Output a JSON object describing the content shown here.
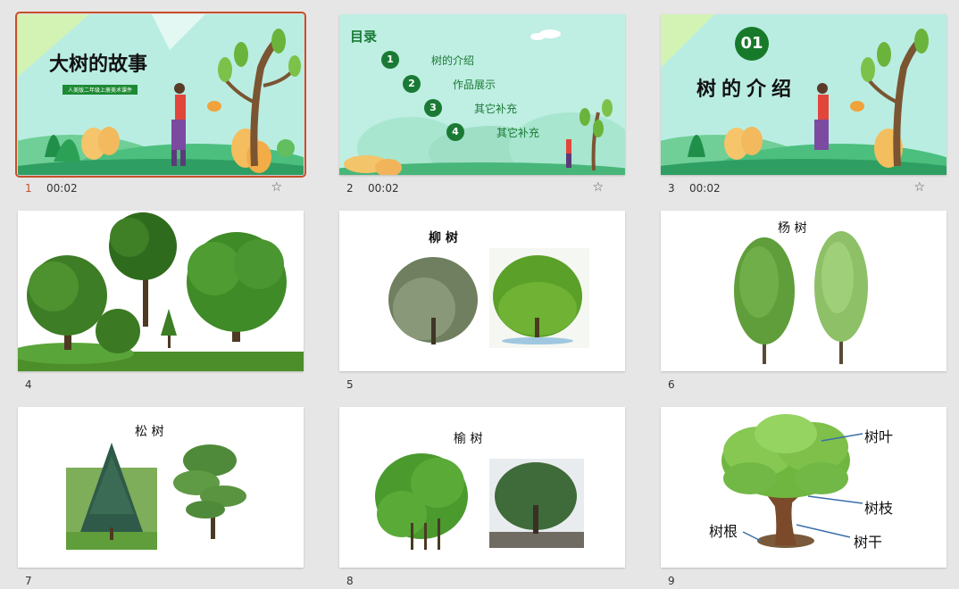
{
  "slides": [
    {
      "number": "1",
      "time": "00:02",
      "title": "大树的故事",
      "subtitle": "人美版二年级上册美术课件",
      "star": "☆"
    },
    {
      "number": "2",
      "time": "00:02",
      "heading": "目录",
      "items": [
        {
          "num": "1",
          "label": "树的介绍"
        },
        {
          "num": "2",
          "label": "作品展示"
        },
        {
          "num": "3",
          "label": "其它补充"
        },
        {
          "num": "4",
          "label": "其它补充"
        }
      ],
      "star": "☆"
    },
    {
      "number": "3",
      "time": "00:02",
      "badge": "01",
      "title": "树的介绍",
      "star": "☆"
    },
    {
      "number": "4"
    },
    {
      "number": "5",
      "title": "柳 树"
    },
    {
      "number": "6",
      "title": "杨 树"
    },
    {
      "number": "7",
      "title": "松 树"
    },
    {
      "number": "8",
      "title": "榆 树"
    },
    {
      "number": "9",
      "labels": {
        "leaf": "树叶",
        "branch": "树枝",
        "root": "树根",
        "trunk": "树干"
      }
    }
  ],
  "colors": {
    "selection": "#c6502a",
    "teal_bg": "#b6ece0",
    "green_dark": "#1a7a35",
    "leaf_green": "#5faa3a"
  }
}
